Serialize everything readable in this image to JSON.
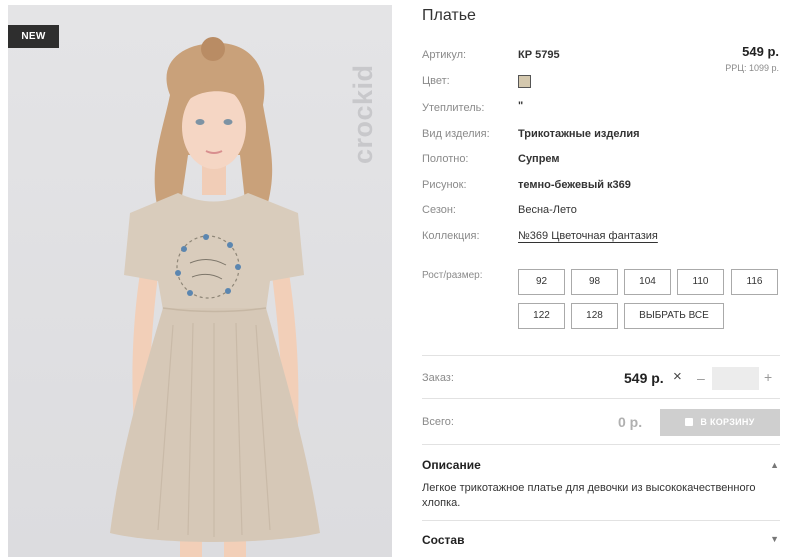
{
  "product": {
    "badge": "NEW",
    "brand": "crockid",
    "title": "Платье"
  },
  "attributes": [
    {
      "label": "Артикул:",
      "value": "КР 5795"
    },
    {
      "label": "Цвет:",
      "value": ""
    },
    {
      "label": "Утеплитель:",
      "value": "\""
    },
    {
      "label": "Вид изделия:",
      "value": "Трикотажные изделия"
    },
    {
      "label": "Полотно:",
      "value": "Супрем"
    },
    {
      "label": "Рисунок:",
      "value": "темно-бежевый к369"
    },
    {
      "label": "Сезон:",
      "value": "Весна-Лето"
    },
    {
      "label": "Коллекция:",
      "value": "№369 Цветочная фантазия"
    }
  ],
  "colors": {
    "swatch": "#d4c8ae",
    "dress": "#d9ccbc",
    "background": "#e0e0e3"
  },
  "price": {
    "main": "549 р.",
    "rrp": "РРЦ: 1099 р."
  },
  "sizes": {
    "label": "Рост/размер:",
    "options": [
      "92",
      "98",
      "104",
      "110",
      "116",
      "122",
      "128"
    ],
    "select_all": "ВЫБРАТЬ ВСЕ"
  },
  "order": {
    "label": "Заказ:",
    "price": "549 р.",
    "times": "×",
    "minus": "–",
    "plus": "+",
    "quantity": ""
  },
  "total": {
    "label": "Всего:",
    "price": "0 р.",
    "cart_button": "В КОРЗИНУ",
    "cart_icon": "shopping-bag-icon"
  },
  "description": {
    "title": "Описание",
    "arrow": "▲",
    "text": "Легкое трикотажное платье для девочки из высококачественного хлопка."
  },
  "composition": {
    "title": "Состав",
    "arrow": "▼"
  }
}
